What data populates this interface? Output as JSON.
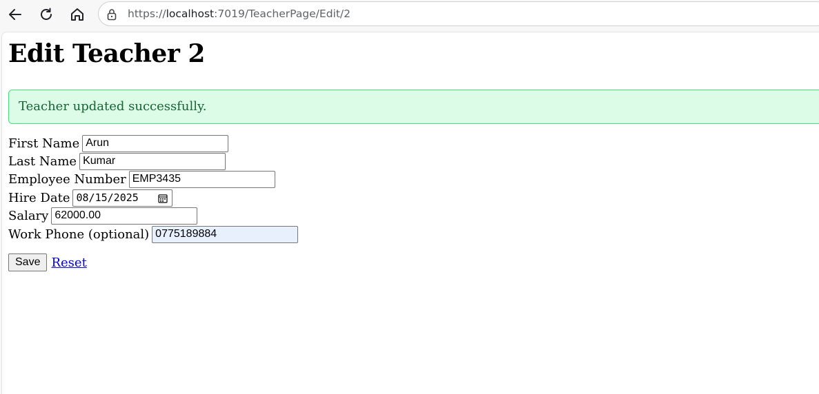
{
  "browser": {
    "url_prefix": "https://",
    "url_host": "localhost",
    "url_path": ":7019/TeacherPage/Edit/2"
  },
  "page": {
    "title": "Edit Teacher 2",
    "alert": "Teacher updated successfully."
  },
  "form": {
    "first_name": {
      "label": "First Name",
      "value": "Arun"
    },
    "last_name": {
      "label": "Last Name",
      "value": "Kumar"
    },
    "employee_number": {
      "label": "Employee Number",
      "value": "EMP3435"
    },
    "hire_date": {
      "label": "Hire Date",
      "value": "08/15/2025"
    },
    "salary": {
      "label": "Salary",
      "value": "62000.00"
    },
    "work_phone": {
      "label": "Work Phone (optional)",
      "value": "0775189884"
    }
  },
  "actions": {
    "save_label": "Save",
    "reset_label": "Reset"
  },
  "colors": {
    "alert_bg": "#dcfce7",
    "alert_border": "#4ade80",
    "alert_text": "#166534",
    "link": "#0000ee",
    "autofill_bg": "#e8f0fe"
  },
  "icons": [
    "back-arrow-icon",
    "reload-icon",
    "home-icon",
    "lock-icon",
    "calendar-icon"
  ]
}
